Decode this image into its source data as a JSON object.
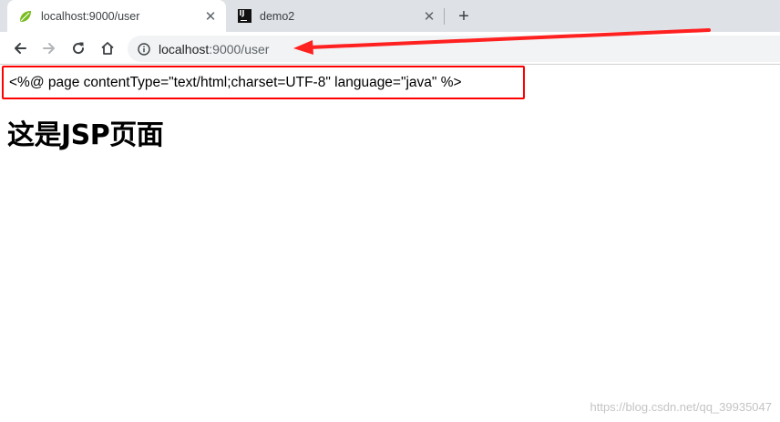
{
  "browser": {
    "tabs": [
      {
        "title": "localhost:9000/user",
        "favicon": "spring-leaf-icon",
        "active": true
      },
      {
        "title": "demo2",
        "favicon": "intellij-icon",
        "active": false
      }
    ],
    "new_tab": "+",
    "close_glyph": "✕",
    "address": {
      "host": "localhost",
      "rest": ":9000/user"
    }
  },
  "page": {
    "directive": "<%@ page contentType=\"text/html;charset=UTF-8\" language=\"java\" %>",
    "heading": "这是JSP页面"
  },
  "annotation": {
    "color": "#ff2020"
  },
  "watermark": "https://blog.csdn.net/qq_39935047"
}
